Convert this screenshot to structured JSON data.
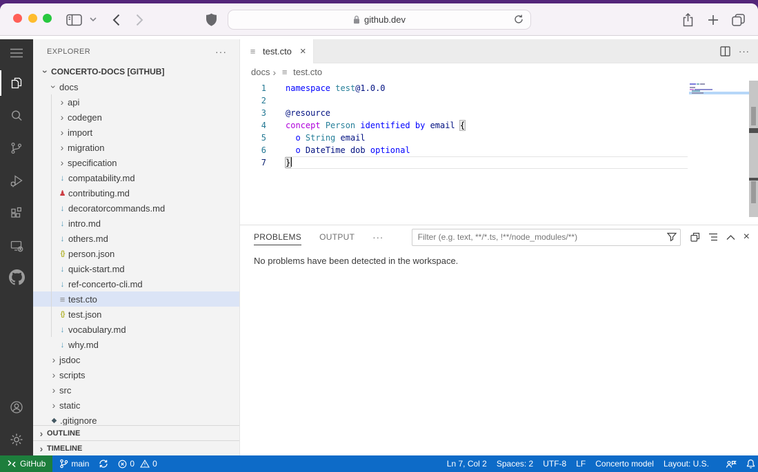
{
  "browser": {
    "url": "github.dev",
    "traffic_lights": [
      "close",
      "minimize",
      "zoom"
    ],
    "icons": [
      "sidebar-icon",
      "chevron-down-icon",
      "back-icon",
      "forward-icon",
      "shield-icon",
      "lock-icon",
      "reload-icon",
      "share-icon",
      "new-tab-icon",
      "tabs-overview-icon"
    ]
  },
  "activity_bar": {
    "items": [
      "menu",
      "explorer",
      "search",
      "source-control",
      "run-debug",
      "extensions",
      "remote-explorer",
      "github"
    ],
    "active_item": "explorer",
    "bottom_items": [
      "account",
      "settings"
    ]
  },
  "explorer": {
    "title": "EXPLORER",
    "actions_label": "···",
    "tree": [
      {
        "label": "CONCERTO-DOCS [GITHUB]",
        "kind": "folder",
        "expanded": true,
        "level": 0,
        "root": true
      },
      {
        "label": "docs",
        "kind": "folder",
        "expanded": true,
        "level": 1
      },
      {
        "label": "api",
        "kind": "folder",
        "expanded": false,
        "level": 2
      },
      {
        "label": "codegen",
        "kind": "folder",
        "expanded": false,
        "level": 2
      },
      {
        "label": "import",
        "kind": "folder",
        "expanded": false,
        "level": 2
      },
      {
        "label": "migration",
        "kind": "folder",
        "expanded": false,
        "level": 2
      },
      {
        "label": "specification",
        "kind": "folder",
        "expanded": false,
        "level": 2
      },
      {
        "label": "compatability.md",
        "kind": "file",
        "icon": "markdown",
        "level": 2
      },
      {
        "label": "contributing.md",
        "kind": "file",
        "icon": "contributing",
        "level": 2
      },
      {
        "label": "decoratorcommands.md",
        "kind": "file",
        "icon": "markdown",
        "level": 2
      },
      {
        "label": "intro.md",
        "kind": "file",
        "icon": "markdown",
        "level": 2
      },
      {
        "label": "others.md",
        "kind": "file",
        "icon": "markdown",
        "level": 2
      },
      {
        "label": "person.json",
        "kind": "file",
        "icon": "json",
        "level": 2
      },
      {
        "label": "quick-start.md",
        "kind": "file",
        "icon": "markdown",
        "level": 2
      },
      {
        "label": "ref-concerto-cli.md",
        "kind": "file",
        "icon": "markdown",
        "level": 2
      },
      {
        "label": "test.cto",
        "kind": "file",
        "icon": "file",
        "level": 2,
        "selected": true
      },
      {
        "label": "test.json",
        "kind": "file",
        "icon": "json",
        "level": 2
      },
      {
        "label": "vocabulary.md",
        "kind": "file",
        "icon": "markdown",
        "level": 2
      },
      {
        "label": "why.md",
        "kind": "file",
        "icon": "markdown",
        "level": 2
      },
      {
        "label": "jsdoc",
        "kind": "folder",
        "expanded": false,
        "level": 1
      },
      {
        "label": "scripts",
        "kind": "folder",
        "expanded": false,
        "level": 1
      },
      {
        "label": "src",
        "kind": "folder",
        "expanded": false,
        "level": 1
      },
      {
        "label": "static",
        "kind": "folder",
        "expanded": false,
        "level": 1
      },
      {
        "label": ".gitignore",
        "kind": "file",
        "icon": "gitignore",
        "level": 1
      }
    ],
    "bottom_sections": [
      {
        "label": "OUTLINE"
      },
      {
        "label": "TIMELINE"
      }
    ]
  },
  "editor": {
    "tab": {
      "label": "test.cto"
    },
    "more_label": "···",
    "breadcrumb": {
      "folder": "docs",
      "file": "test.cto"
    },
    "lines": [
      {
        "num": "1",
        "tokens": [
          [
            "namespace",
            "kw"
          ],
          [
            " ",
            "pl"
          ],
          [
            "test",
            "type"
          ],
          [
            "@1.0.0",
            "id"
          ]
        ]
      },
      {
        "num": "2",
        "tokens": []
      },
      {
        "num": "3",
        "tokens": [
          [
            "@resource",
            "id"
          ]
        ]
      },
      {
        "num": "4",
        "tokens": [
          [
            "concept",
            "ctrl"
          ],
          [
            " ",
            "pl"
          ],
          [
            "Person",
            "type"
          ],
          [
            " ",
            "pl"
          ],
          [
            "identified by",
            "kw"
          ],
          [
            " ",
            "pl"
          ],
          [
            "email",
            "id"
          ],
          [
            " ",
            "pl"
          ],
          [
            "{",
            "match"
          ]
        ]
      },
      {
        "num": "5",
        "tokens": [
          [
            "  ",
            "pl"
          ],
          [
            "o",
            "kw"
          ],
          [
            " ",
            "pl"
          ],
          [
            "String",
            "type"
          ],
          [
            " ",
            "pl"
          ],
          [
            "email",
            "id"
          ]
        ]
      },
      {
        "num": "6",
        "tokens": [
          [
            "  ",
            "pl"
          ],
          [
            "o",
            "kw"
          ],
          [
            " ",
            "pl"
          ],
          [
            "DateTime",
            "id"
          ],
          [
            " ",
            "pl"
          ],
          [
            "dob",
            "id"
          ],
          [
            " ",
            "pl"
          ],
          [
            "optional",
            "kw"
          ]
        ]
      },
      {
        "num": "7",
        "tokens": [
          [
            "}",
            "match"
          ]
        ],
        "current": true,
        "cursor": true
      }
    ],
    "token_colors": {
      "keyword": "#0000ff",
      "type": "#267f99",
      "identifier": "#001080",
      "control": "#af00db",
      "plain": "#000000"
    }
  },
  "panel": {
    "tabs": [
      {
        "label": "PROBLEMS",
        "active": true
      },
      {
        "label": "OUTPUT",
        "active": false
      }
    ],
    "tab_overflow": "···",
    "filter_placeholder": "Filter (e.g. text, **/*.ts, !**/node_modules/**)",
    "actions": [
      "filter",
      "group",
      "view-as-list",
      "maximize",
      "close"
    ],
    "message": "No problems have been detected in the workspace."
  },
  "status_bar": {
    "remote_label": "GitHub",
    "branch": "main",
    "errors": "0",
    "warnings": "0",
    "right_items": [
      "Ln 7, Col 2",
      "Spaces: 2",
      "UTF-8",
      "LF",
      "Concerto model",
      "Layout: U.S."
    ],
    "colors": {
      "background": "#0d6bc8",
      "remote_background": "#1d7e3c"
    }
  },
  "colors": {
    "desktop": "#54267a",
    "toolbar": "#f6f2f7",
    "activity_bar": "#333333",
    "sidebar": "#f3f3f3",
    "tree_selection": "#dbe4f6",
    "tab_bar": "#ececec",
    "minimap_current_line": "#b6d7f8"
  }
}
